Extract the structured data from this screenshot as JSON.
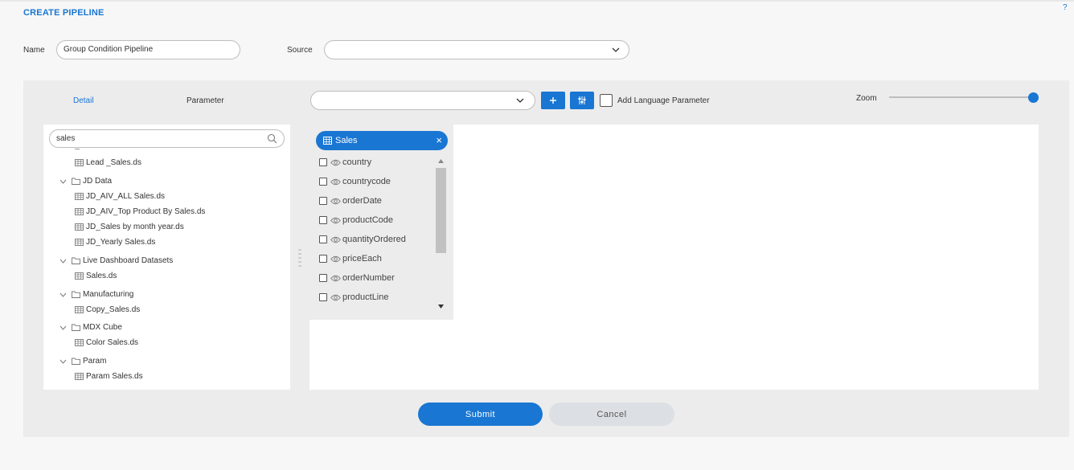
{
  "page": {
    "title": "CREATE PIPELINE",
    "help": "?"
  },
  "form": {
    "name_label": "Name",
    "name_value": "Group Condition Pipeline",
    "source_label": "Source",
    "source_value": ""
  },
  "tabs": {
    "detail": "Detail",
    "parameter": "Parameter"
  },
  "toolbar": {
    "param_select_value": "",
    "add_icon": "plus-icon",
    "filter_icon": "sliders-icon",
    "add_language_label": "Add Language Parameter",
    "add_language_checked": false,
    "zoom_label": "Zoom",
    "zoom_level": 1.0
  },
  "tree": {
    "search_value": "sales",
    "items": [
      {
        "label": "Lead _Sales.ds",
        "type": "dataset"
      },
      {
        "label": "JD Data",
        "type": "folder"
      },
      {
        "label": "JD_AIV_ALL Sales.ds",
        "type": "dataset"
      },
      {
        "label": "JD_AIV_Top Product By Sales.ds",
        "type": "dataset"
      },
      {
        "label": "JD_Sales by month year.ds",
        "type": "dataset"
      },
      {
        "label": "JD_Yearly Sales.ds",
        "type": "dataset"
      },
      {
        "label": "Live Dashboard Datasets",
        "type": "folder"
      },
      {
        "label": "Sales.ds",
        "type": "dataset"
      },
      {
        "label": "Manufacturing",
        "type": "folder"
      },
      {
        "label": "Copy_Sales.ds",
        "type": "dataset"
      },
      {
        "label": "MDX Cube",
        "type": "folder"
      },
      {
        "label": "Color Sales.ds",
        "type": "dataset"
      },
      {
        "label": "Param",
        "type": "folder"
      },
      {
        "label": "Param Sales.ds",
        "type": "dataset"
      }
    ]
  },
  "dataset_card": {
    "title": "Sales",
    "close": "×",
    "fields": [
      "country",
      "countrycode",
      "orderDate",
      "productCode",
      "quantityOrdered",
      "priceEach",
      "orderNumber",
      "productLine"
    ]
  },
  "actions": {
    "submit": "Submit",
    "cancel": "Cancel"
  },
  "colors": {
    "accent": "#1976d2",
    "panel": "#ececec"
  }
}
